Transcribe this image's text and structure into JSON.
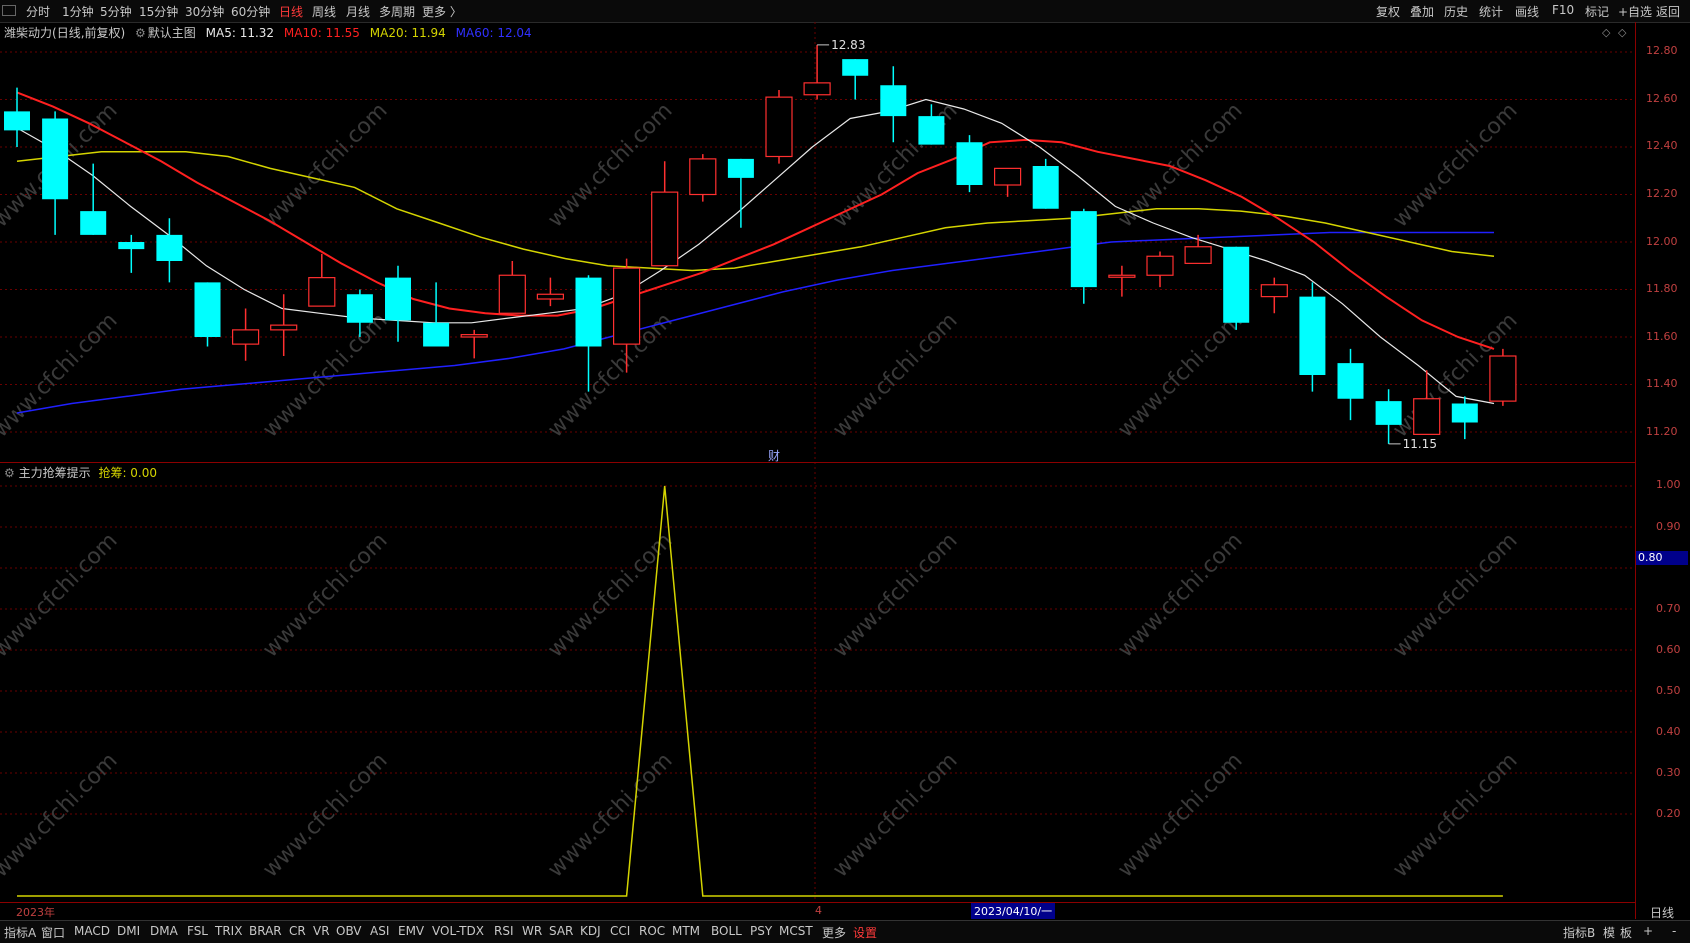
{
  "toolbar": {
    "periods": [
      "分时",
      "1分钟",
      "5分钟",
      "15分钟",
      "30分钟",
      "60分钟",
      "日线",
      "周线",
      "月线",
      "多周期",
      "更多 〉"
    ],
    "active_period": "日线",
    "right_buttons": [
      "复权",
      "叠加",
      "历史",
      "统计",
      "画线",
      "F10",
      "标记",
      "+自选",
      "返回"
    ]
  },
  "legend": {
    "stock": "潍柴动力",
    "period": "(日线,前复权)",
    "main_chart": "默认主图",
    "ma5": "MA5: 11.32",
    "ma10": "MA10: 11.55",
    "ma20": "MA20: 11.94",
    "ma60": "MA60: 12.04"
  },
  "indicator": {
    "name": "主力抢筹提示",
    "value_label": "抢筹: 0.00"
  },
  "annotations": {
    "high": "12.83",
    "low": "11.15",
    "fin": "财"
  },
  "date_axis": {
    "year": "2023年",
    "month": "4",
    "cursor_date": "2023/04/10/一"
  },
  "right_axis": {
    "price_ticks": [
      "12.80",
      "12.60",
      "12.40",
      "12.20",
      "12.00",
      "11.80",
      "11.60",
      "11.40",
      "11.20"
    ],
    "ind_ticks": [
      "1.00",
      "0.90",
      "0.80",
      "0.70",
      "0.60",
      "0.50",
      "0.40",
      "0.30",
      "0.20"
    ],
    "highlight": "0.80",
    "period_label": "日线"
  },
  "bottom_tabs": [
    "指标A",
    "窗口",
    "MACD",
    "DMI",
    "DMA",
    "FSL",
    "TRIX",
    "BRAR",
    "CR",
    "VR",
    "OBV",
    "ASI",
    "EMV",
    "VOL-TDX",
    "RSI",
    "WR",
    "SAR",
    "KDJ",
    "CCI",
    "ROC",
    "MTM",
    "BOLL",
    "PSY",
    "MCST",
    "更多",
    "设置"
  ],
  "bottom_right": [
    "指标B",
    "模",
    "板",
    "+",
    "-"
  ],
  "watermark": "www.cfchi.com",
  "colors": {
    "up": "#ff3030",
    "down": "#00ffff",
    "ma5": "#e8e8e8",
    "ma10": "#ff2020",
    "ma20": "#d4d400",
    "ma60": "#2020ff",
    "ind": "#d4d400"
  },
  "chart_data": {
    "type": "candlestick",
    "ylim": [
      11.1,
      12.9
    ],
    "candles": [
      {
        "o": 12.55,
        "c": 12.47,
        "h": 12.65,
        "l": 12.4
      },
      {
        "o": 12.52,
        "c": 12.18,
        "h": 12.55,
        "l": 12.03
      },
      {
        "o": 12.13,
        "c": 12.03,
        "h": 12.33,
        "l": 12.03
      },
      {
        "o": 12.0,
        "c": 11.97,
        "h": 12.03,
        "l": 11.87
      },
      {
        "o": 12.03,
        "c": 11.92,
        "h": 12.1,
        "l": 11.83
      },
      {
        "o": 11.83,
        "c": 11.6,
        "h": 11.83,
        "l": 11.56
      },
      {
        "o": 11.57,
        "c": 11.63,
        "h": 11.72,
        "l": 11.5
      },
      {
        "o": 11.63,
        "c": 11.65,
        "h": 11.78,
        "l": 11.52
      },
      {
        "o": 11.73,
        "c": 11.85,
        "h": 11.95,
        "l": 11.73
      },
      {
        "o": 11.78,
        "c": 11.66,
        "h": 11.8,
        "l": 11.6
      },
      {
        "o": 11.85,
        "c": 11.67,
        "h": 11.9,
        "l": 11.58
      },
      {
        "o": 11.66,
        "c": 11.56,
        "h": 11.83,
        "l": 11.56
      },
      {
        "o": 11.6,
        "c": 11.61,
        "h": 11.63,
        "l": 11.51
      },
      {
        "o": 11.7,
        "c": 11.86,
        "h": 11.92,
        "l": 11.7
      },
      {
        "o": 11.76,
        "c": 11.78,
        "h": 11.85,
        "l": 11.73
      },
      {
        "o": 11.85,
        "c": 11.56,
        "h": 11.86,
        "l": 11.37
      },
      {
        "o": 11.57,
        "c": 11.89,
        "h": 11.93,
        "l": 11.45
      },
      {
        "o": 11.9,
        "c": 12.21,
        "h": 12.34,
        "l": 11.9
      },
      {
        "o": 12.2,
        "c": 12.35,
        "h": 12.37,
        "l": 12.17
      },
      {
        "o": 12.35,
        "c": 12.27,
        "h": 12.35,
        "l": 12.06
      },
      {
        "o": 12.36,
        "c": 12.61,
        "h": 12.64,
        "l": 12.33
      },
      {
        "o": 12.62,
        "c": 12.67,
        "h": 12.83,
        "l": 12.6
      },
      {
        "o": 12.77,
        "c": 12.7,
        "h": 12.77,
        "l": 12.6
      },
      {
        "o": 12.66,
        "c": 12.53,
        "h": 12.74,
        "l": 12.42
      },
      {
        "o": 12.53,
        "c": 12.41,
        "h": 12.58,
        "l": 12.41
      },
      {
        "o": 12.42,
        "c": 12.24,
        "h": 12.45,
        "l": 12.21
      },
      {
        "o": 12.24,
        "c": 12.31,
        "h": 12.31,
        "l": 12.19
      },
      {
        "o": 12.32,
        "c": 12.14,
        "h": 12.35,
        "l": 12.14
      },
      {
        "o": 12.13,
        "c": 11.81,
        "h": 12.14,
        "l": 11.74
      },
      {
        "o": 11.86,
        "c": 11.86,
        "h": 11.9,
        "l": 11.77
      },
      {
        "o": 11.86,
        "c": 11.94,
        "h": 11.96,
        "l": 11.81
      },
      {
        "o": 11.91,
        "c": 11.98,
        "h": 12.03,
        "l": 11.91
      },
      {
        "o": 11.98,
        "c": 11.66,
        "h": 11.98,
        "l": 11.63
      },
      {
        "o": 11.77,
        "c": 11.82,
        "h": 11.85,
        "l": 11.7
      },
      {
        "o": 11.77,
        "c": 11.44,
        "h": 11.83,
        "l": 11.37
      },
      {
        "o": 11.49,
        "c": 11.34,
        "h": 11.55,
        "l": 11.25
      },
      {
        "o": 11.33,
        "c": 11.23,
        "h": 11.38,
        "l": 11.15
      },
      {
        "o": 11.19,
        "c": 11.34,
        "h": 11.46,
        "l": 11.19
      },
      {
        "o": 11.32,
        "c": 11.24,
        "h": 11.35,
        "l": 11.17
      },
      {
        "o": 11.33,
        "c": 11.52,
        "h": 11.55,
        "l": 11.31
      }
    ],
    "ma5": [
      12.48,
      12.39,
      12.28,
      12.15,
      12.03,
      11.9,
      11.8,
      11.72,
      11.7,
      11.68,
      11.67,
      11.66,
      11.66,
      11.68,
      11.7,
      11.72,
      11.78,
      11.88,
      11.99,
      12.12,
      12.26,
      12.4,
      12.52,
      12.55,
      12.6,
      12.56,
      12.5,
      12.4,
      12.28,
      12.15,
      12.08,
      12.02,
      11.97,
      11.92,
      11.86,
      11.74,
      11.6,
      11.48,
      11.35,
      11.32
    ],
    "ma10": [
      12.63,
      12.57,
      12.5,
      12.42,
      12.34,
      12.25,
      12.17,
      12.09,
      12.0,
      11.91,
      11.83,
      11.76,
      11.72,
      11.7,
      11.69,
      11.69,
      11.72,
      11.77,
      11.82,
      11.87,
      11.93,
      11.99,
      12.06,
      12.13,
      12.2,
      12.29,
      12.35,
      12.42,
      12.43,
      12.42,
      12.38,
      12.35,
      12.32,
      12.26,
      12.19,
      12.1,
      12.0,
      11.88,
      11.77,
      11.67,
      11.6,
      11.55
    ],
    "ma20": [
      12.34,
      12.36,
      12.38,
      12.38,
      12.38,
      12.36,
      12.31,
      12.27,
      12.23,
      12.14,
      12.08,
      12.02,
      11.97,
      11.93,
      11.9,
      11.89,
      11.88,
      11.89,
      11.92,
      11.95,
      11.98,
      12.02,
      12.06,
      12.08,
      12.09,
      12.1,
      12.12,
      12.14,
      12.14,
      12.13,
      12.11,
      12.08,
      12.04,
      12.0,
      11.96,
      11.94
    ],
    "ma60": [
      11.28,
      11.32,
      11.35,
      11.38,
      11.4,
      11.42,
      11.44,
      11.46,
      11.48,
      11.51,
      11.55,
      11.61,
      11.67,
      11.73,
      11.79,
      11.84,
      11.88,
      11.91,
      11.94,
      11.97,
      12.0,
      12.01,
      12.02,
      12.03,
      12.04,
      12.04,
      12.04,
      12.04
    ],
    "indicator": {
      "ylim": [
        0,
        1.05
      ],
      "values": [
        0,
        0,
        0,
        0,
        0,
        0,
        0,
        0,
        0,
        0,
        0,
        0,
        0,
        0,
        0,
        0,
        0,
        1,
        0,
        0,
        0,
        0,
        0,
        0,
        0,
        0,
        0,
        0,
        0,
        0,
        0,
        0,
        0,
        0,
        0,
        0,
        0,
        0,
        0,
        0
      ]
    }
  }
}
